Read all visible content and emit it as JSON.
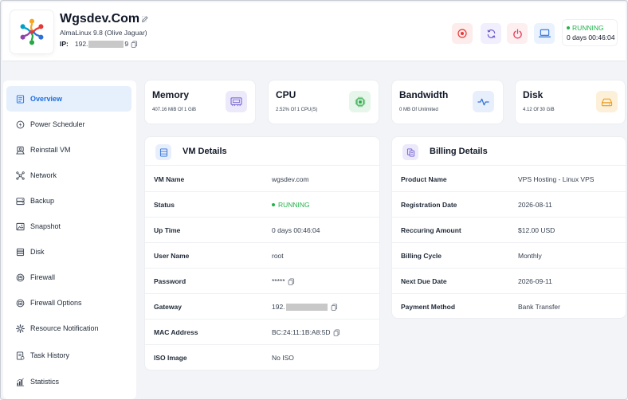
{
  "server": {
    "name": "Wgsdev.Com",
    "os": "AlmaLinux 9.8 (Olive Jaguar)",
    "ip_label": "IP:",
    "ip_prefix": "192.",
    "ip_suffix": "9",
    "status": "RUNNING",
    "uptime": "0 days 00:46:04"
  },
  "sidebar": {
    "items": [
      {
        "label": "Overview"
      },
      {
        "label": "Power Scheduler"
      },
      {
        "label": "Reinstall VM"
      },
      {
        "label": "Network"
      },
      {
        "label": "Backup"
      },
      {
        "label": "Snapshot"
      },
      {
        "label": "Disk"
      },
      {
        "label": "Firewall"
      },
      {
        "label": "Firewall Options"
      },
      {
        "label": "Resource Notification"
      },
      {
        "label": "Task History"
      },
      {
        "label": "Statistics"
      }
    ]
  },
  "stats": {
    "memory": {
      "title": "Memory",
      "sub": "407.16 MiB Of 1 GiB"
    },
    "cpu": {
      "title": "CPU",
      "sub": "2.52% Of 1 CPU(S)"
    },
    "bandwidth": {
      "title": "Bandwidth",
      "sub": "0 MB Of Unlimited"
    },
    "disk": {
      "title": "Disk",
      "sub": "4.12 Of 30 GiB"
    }
  },
  "vm_details": {
    "title": "VM Details",
    "rows": [
      {
        "key": "VM Name",
        "value": "wgsdev.com"
      },
      {
        "key": "Status",
        "value": "RUNNING"
      },
      {
        "key": "Up Time",
        "value": "0 days 00:46:04"
      },
      {
        "key": "User Name",
        "value": "root"
      },
      {
        "key": "Password",
        "value": "*****"
      },
      {
        "key": "Gateway",
        "value": "192."
      },
      {
        "key": "MAC Address",
        "value": "BC:24:11:1B:A8:5D"
      },
      {
        "key": "ISO Image",
        "value": "No ISO"
      }
    ]
  },
  "billing_details": {
    "title": "Billing Details",
    "rows": [
      {
        "key": "Product Name",
        "value": "VPS Hosting - Linux VPS"
      },
      {
        "key": "Registration Date",
        "value": "2026-08-11"
      },
      {
        "key": "Reccuring Amount",
        "value": "$12.00 USD"
      },
      {
        "key": "Billing Cycle",
        "value": "Monthly"
      },
      {
        "key": "Next Due Date",
        "value": "2026-09-11"
      },
      {
        "key": "Payment Method",
        "value": "Bank Transfer"
      }
    ]
  },
  "colors": {
    "accent": "#1d6fe0",
    "running": "#22b24c",
    "stop": "#e53935",
    "restart": "#6d5bd0",
    "power": "#e23b5a",
    "console": "#2f6fd6"
  }
}
